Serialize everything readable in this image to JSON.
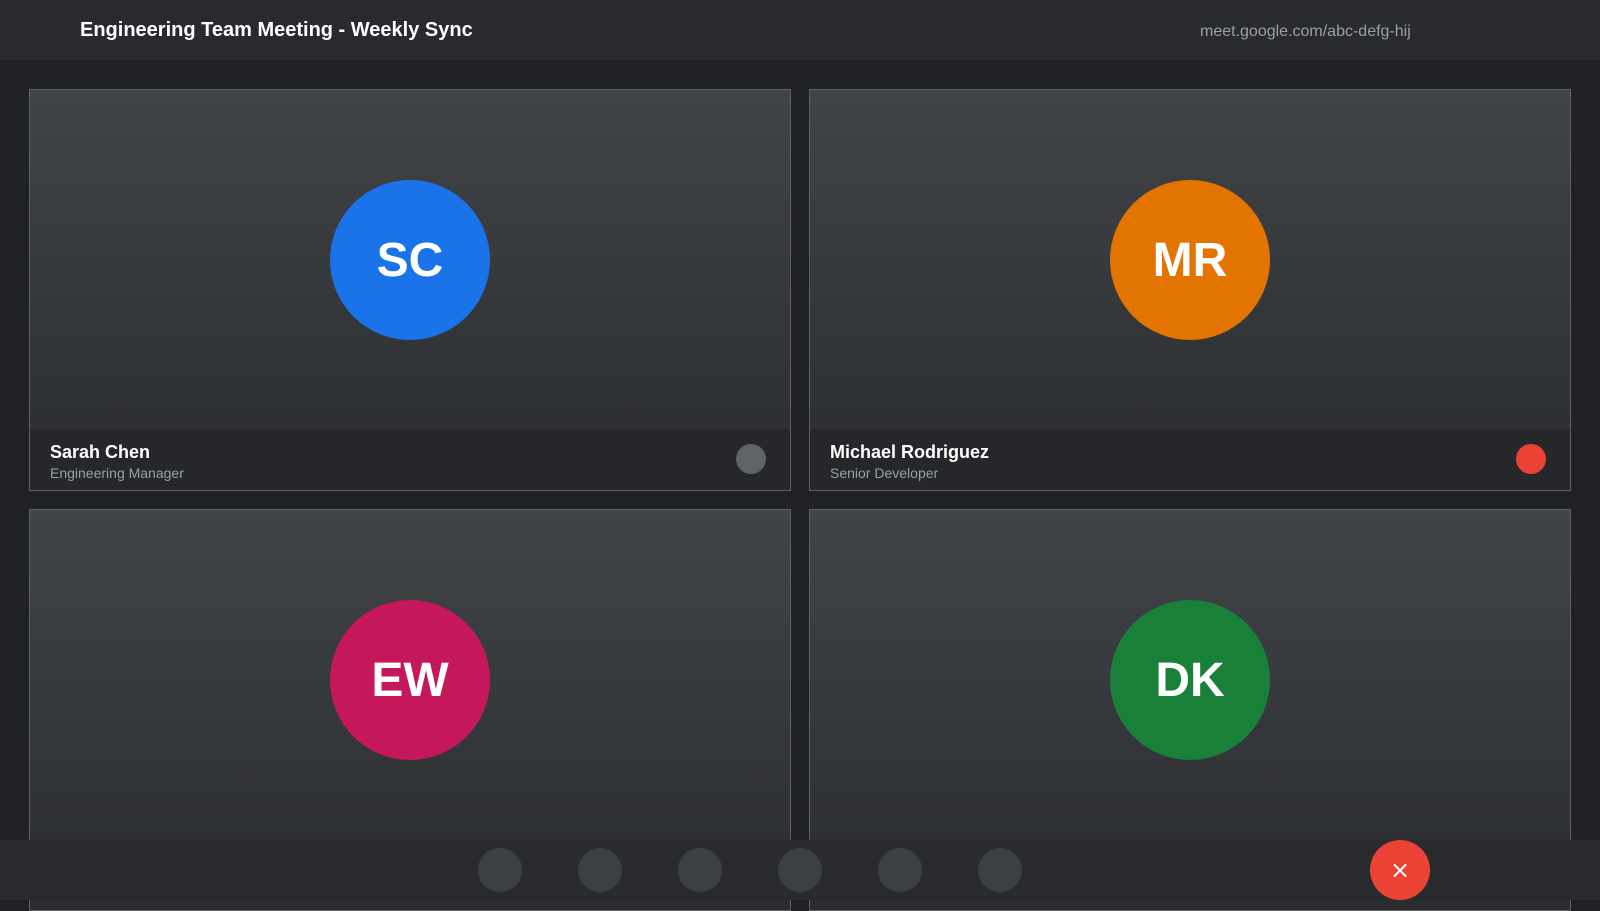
{
  "header": {
    "title": "Engineering Team Meeting - Weekly Sync",
    "url": "meet.google.com/abc-defg-hij"
  },
  "participants": [
    {
      "initials": "SC",
      "name": "Sarah Chen",
      "role": "Engineering Manager",
      "avatar_color": "#1a73e8",
      "status_color": "#5f6368"
    },
    {
      "initials": "MR",
      "name": "Michael Rodriguez",
      "role": "Senior Developer",
      "avatar_color": "#e37400",
      "status_color": "#ea4335"
    },
    {
      "initials": "EW",
      "avatar_color": "#c5175b"
    },
    {
      "initials": "DK",
      "avatar_color": "#188038"
    }
  ],
  "controls": {
    "end_call_icon": "close-icon",
    "end_call_glyph": "×"
  },
  "colors": {
    "background": "#202124",
    "bar": "#292a2d",
    "control_button": "#3c4043",
    "end_call": "#ea4335"
  }
}
